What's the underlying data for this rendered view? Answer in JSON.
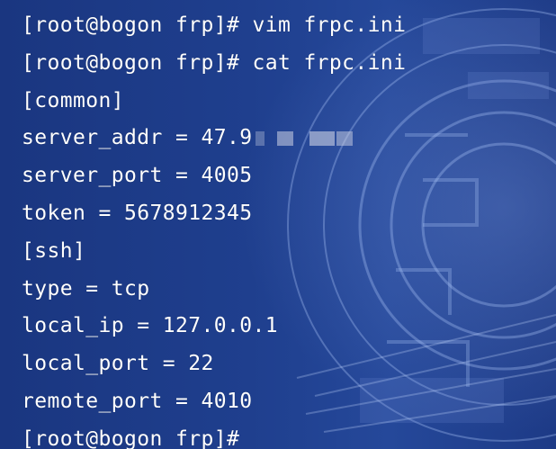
{
  "terminal": {
    "lines": [
      "[root@bogon frp]# vim frpc.ini",
      "[root@bogon frp]# cat frpc.ini",
      "[common]",
      "server_addr = 47.9",
      "server_port = 4005",
      "token = 5678912345",
      "[ssh]",
      "type = tcp",
      "local_ip = 127.0.0.1",
      "local_port = 22",
      "remote_port = 4010",
      "[root@bogon frp]#"
    ]
  },
  "colors": {
    "background": "#1c3a86",
    "text": "#ffffff"
  }
}
